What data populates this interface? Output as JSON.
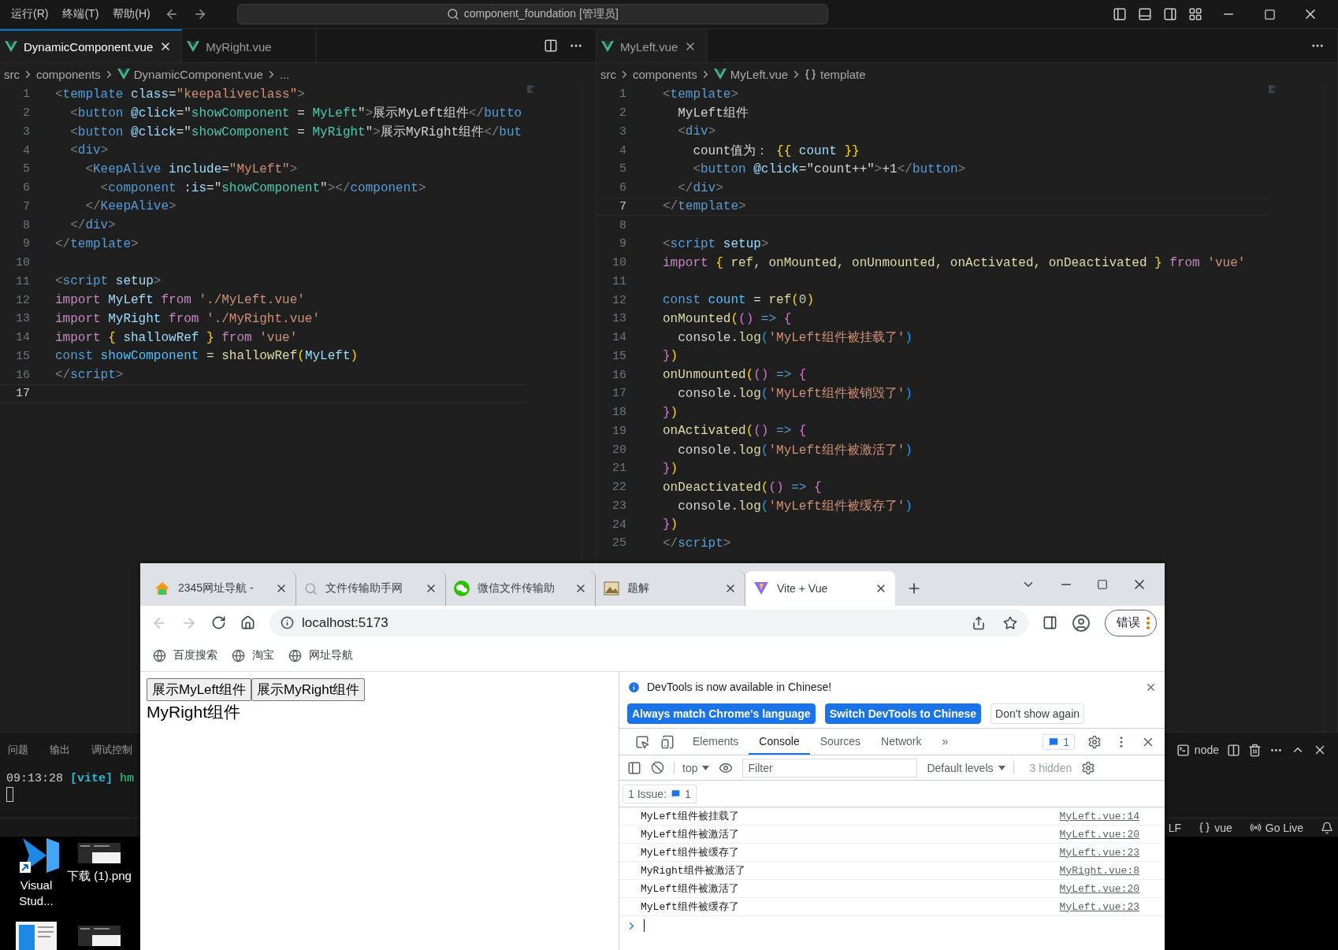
{
  "vscode": {
    "menu": [
      "运行(R)",
      "终端(T)",
      "帮助(H)"
    ],
    "command_center": "component_foundation [管理员]",
    "editors": [
      {
        "focused": true,
        "tabs": [
          {
            "label": "DynamicComponent.vue",
            "selected": true
          },
          {
            "label": "MyRight.vue",
            "selected": false
          }
        ],
        "breadcrumbs": [
          {
            "kind": "folder",
            "text": "src"
          },
          {
            "kind": "folder",
            "text": "components"
          },
          {
            "kind": "file",
            "text": "DynamicComponent.vue"
          },
          {
            "kind": "more",
            "text": "..."
          }
        ],
        "lines": [
          {
            "number": "1",
            "current": false,
            "tokens": [
              {
                "kind": "punctuation",
                "text": "<"
              },
              {
                "kind": "tag",
                "text": "template"
              },
              {
                "kind": "attribute",
                "text": " class"
              },
              {
                "kind": "text",
                "text": "="
              },
              {
                "kind": "string",
                "text": "\"keepaliveclass\""
              },
              {
                "kind": "punctuation",
                "text": ">"
              }
            ]
          },
          {
            "number": "2",
            "current": false,
            "tokens": [
              {
                "kind": "punctuation",
                "text": "  <"
              },
              {
                "kind": "tag",
                "text": "button"
              },
              {
                "kind": "attribute",
                "text": " @click"
              },
              {
                "kind": "text",
                "text": "=\""
              },
              {
                "kind": "expression",
                "text": "showComponent"
              },
              {
                "kind": "text",
                "text": " = "
              },
              {
                "kind": "expression",
                "text": "MyLeft"
              },
              {
                "kind": "text",
                "text": "\""
              },
              {
                "kind": "punctuation",
                "text": ">"
              },
              {
                "kind": "text",
                "text": "展示MyLeft组件"
              },
              {
                "kind": "punctuation",
                "text": "</"
              },
              {
                "kind": "tag",
                "text": "butto"
              }
            ]
          },
          {
            "number": "3",
            "current": false,
            "tokens": [
              {
                "kind": "punctuation",
                "text": "  <"
              },
              {
                "kind": "tag",
                "text": "button"
              },
              {
                "kind": "attribute",
                "text": " @click"
              },
              {
                "kind": "text",
                "text": "=\""
              },
              {
                "kind": "expression",
                "text": "showComponent"
              },
              {
                "kind": "text",
                "text": " = "
              },
              {
                "kind": "expression",
                "text": "MyRight"
              },
              {
                "kind": "text",
                "text": "\""
              },
              {
                "kind": "punctuation",
                "text": ">"
              },
              {
                "kind": "text",
                "text": "展示MyRight组件"
              },
              {
                "kind": "punctuation",
                "text": "</"
              },
              {
                "kind": "tag",
                "text": "but"
              }
            ]
          },
          {
            "number": "4",
            "current": false,
            "tokens": [
              {
                "kind": "punctuation",
                "text": "  <"
              },
              {
                "kind": "tag",
                "text": "div"
              },
              {
                "kind": "punctuation",
                "text": ">"
              }
            ]
          },
          {
            "number": "5",
            "current": false,
            "tokens": [
              {
                "kind": "punctuation",
                "text": "    <"
              },
              {
                "kind": "tag",
                "text": "KeepAlive"
              },
              {
                "kind": "attribute",
                "text": " include"
              },
              {
                "kind": "text",
                "text": "="
              },
              {
                "kind": "string",
                "text": "\"MyLeft\""
              },
              {
                "kind": "punctuation",
                "text": ">"
              }
            ]
          },
          {
            "number": "6",
            "current": false,
            "tokens": [
              {
                "kind": "punctuation",
                "text": "      <"
              },
              {
                "kind": "tag",
                "text": "component"
              },
              {
                "kind": "attribute",
                "text": " :is"
              },
              {
                "kind": "text",
                "text": "=\""
              },
              {
                "kind": "expression",
                "text": "showComponent"
              },
              {
                "kind": "text",
                "text": "\""
              },
              {
                "kind": "punctuation",
                "text": "></"
              },
              {
                "kind": "tag",
                "text": "component"
              },
              {
                "kind": "punctuation",
                "text": ">"
              }
            ]
          },
          {
            "number": "7",
            "current": false,
            "tokens": [
              {
                "kind": "punctuation",
                "text": "    </"
              },
              {
                "kind": "tag",
                "text": "KeepAlive"
              },
              {
                "kind": "punctuation",
                "text": ">"
              }
            ]
          },
          {
            "number": "8",
            "current": false,
            "tokens": [
              {
                "kind": "punctuation",
                "text": "  </"
              },
              {
                "kind": "tag",
                "text": "div"
              },
              {
                "kind": "punctuation",
                "text": ">"
              }
            ]
          },
          {
            "number": "9",
            "current": false,
            "tokens": [
              {
                "kind": "punctuation",
                "text": "</"
              },
              {
                "kind": "tag",
                "text": "template"
              },
              {
                "kind": "punctuation",
                "text": ">"
              }
            ]
          },
          {
            "number": "10",
            "current": false
          },
          {
            "number": "11",
            "current": false,
            "tokens": [
              {
                "kind": "punctuation",
                "text": "<"
              },
              {
                "kind": "tag",
                "text": "script"
              },
              {
                "kind": "attribute",
                "text": " setup"
              },
              {
                "kind": "punctuation",
                "text": ">"
              }
            ]
          },
          {
            "number": "12",
            "current": false,
            "tokens": [
              {
                "kind": "keyword",
                "text": "import"
              },
              {
                "kind": "attribute",
                "text": " MyLeft"
              },
              {
                "kind": "keyword",
                "text": " from"
              },
              {
                "kind": "string",
                "text": " './MyLeft.vue'"
              }
            ]
          },
          {
            "number": "13",
            "current": false,
            "tokens": [
              {
                "kind": "keyword",
                "text": "import"
              },
              {
                "kind": "attribute",
                "text": " MyRight"
              },
              {
                "kind": "keyword",
                "text": " from"
              },
              {
                "kind": "string",
                "text": " './MyRight.vue'"
              }
            ]
          },
          {
            "number": "14",
            "current": false,
            "tokens": [
              {
                "kind": "keyword",
                "text": "import"
              },
              {
                "kind": "bracket1",
                "text": " {"
              },
              {
                "kind": "attribute",
                "text": " shallowRef"
              },
              {
                "kind": "bracket1",
                "text": " }"
              },
              {
                "kind": "keyword",
                "text": " from"
              },
              {
                "kind": "string",
                "text": " 'vue'"
              }
            ]
          },
          {
            "number": "15",
            "current": false,
            "tokens": [
              {
                "kind": "declaration",
                "text": "const"
              },
              {
                "kind": "variable",
                "text": " showComponent"
              },
              {
                "kind": "text",
                "text": " = "
              },
              {
                "kind": "function",
                "text": "shallowRef"
              },
              {
                "kind": "bracket1",
                "text": "("
              },
              {
                "kind": "attribute",
                "text": "MyLeft"
              },
              {
                "kind": "bracket1",
                "text": ")"
              }
            ]
          },
          {
            "number": "16",
            "current": false,
            "tokens": [
              {
                "kind": "punctuation",
                "text": "</"
              },
              {
                "kind": "tag",
                "text": "script"
              },
              {
                "kind": "punctuation",
                "text": ">"
              }
            ]
          },
          {
            "number": "17",
            "current": true
          }
        ]
      },
      {
        "focused": false,
        "tabs": [
          {
            "label": "MyLeft.vue",
            "selected": true
          }
        ],
        "breadcrumbs": [
          {
            "kind": "folder",
            "text": "src"
          },
          {
            "kind": "folder",
            "text": "components"
          },
          {
            "kind": "file",
            "text": "MyLeft.vue"
          },
          {
            "kind": "symbol",
            "text": "template"
          }
        ],
        "lines": [
          {
            "number": "1",
            "current": false,
            "tokens": [
              {
                "kind": "punctuation",
                "text": "<"
              },
              {
                "kind": "tag",
                "text": "template"
              },
              {
                "kind": "punctuation",
                "text": ">"
              }
            ]
          },
          {
            "number": "2",
            "current": false,
            "tokens": [
              {
                "kind": "text",
                "text": "  MyLeft组件"
              }
            ]
          },
          {
            "number": "3",
            "current": false,
            "tokens": [
              {
                "kind": "punctuation",
                "text": "  <"
              },
              {
                "kind": "tag",
                "text": "div"
              },
              {
                "kind": "punctuation",
                "text": ">"
              }
            ]
          },
          {
            "number": "4",
            "current": false,
            "tokens": [
              {
                "kind": "text",
                "text": "    count值为："
              },
              {
                "kind": "bracket1",
                "text": " {{"
              },
              {
                "kind": "attribute",
                "text": " count"
              },
              {
                "kind": "bracket1",
                "text": " }}"
              }
            ]
          },
          {
            "number": "5",
            "current": false,
            "tokens": [
              {
                "kind": "punctuation",
                "text": "    <"
              },
              {
                "kind": "tag",
                "text": "button"
              },
              {
                "kind": "attribute",
                "text": " @click"
              },
              {
                "kind": "text",
                "text": "=\"count++\""
              },
              {
                "kind": "punctuation",
                "text": ">"
              },
              {
                "kind": "text",
                "text": "+1"
              },
              {
                "kind": "punctuation",
                "text": "</"
              },
              {
                "kind": "tag",
                "text": "button"
              },
              {
                "kind": "punctuation",
                "text": ">"
              }
            ]
          },
          {
            "number": "6",
            "current": false,
            "tokens": [
              {
                "kind": "punctuation",
                "text": "  </"
              },
              {
                "kind": "tag",
                "text": "div"
              },
              {
                "kind": "punctuation",
                "text": ">"
              }
            ]
          },
          {
            "number": "7",
            "current": true,
            "tokens": [
              {
                "kind": "punctuation",
                "text": "</"
              },
              {
                "kind": "tag",
                "text": "template"
              },
              {
                "kind": "punctuation",
                "text": ">"
              }
            ]
          },
          {
            "number": "8",
            "current": false
          },
          {
            "number": "9",
            "current": false,
            "tokens": [
              {
                "kind": "punctuation",
                "text": "<"
              },
              {
                "kind": "tag",
                "text": "script"
              },
              {
                "kind": "attribute",
                "text": " setup"
              },
              {
                "kind": "punctuation",
                "text": ">"
              }
            ]
          },
          {
            "number": "10",
            "current": false,
            "tokens": [
              {
                "kind": "keyword",
                "text": "import"
              },
              {
                "kind": "bracket1",
                "text": " {"
              },
              {
                "kind": "function",
                "text": " ref, onMounted, onUnmounted, onActivated, onDeactivated"
              },
              {
                "kind": "bracket1",
                "text": " }"
              },
              {
                "kind": "keyword",
                "text": " from"
              },
              {
                "kind": "string",
                "text": " 'vue'"
              }
            ]
          },
          {
            "number": "11",
            "current": false
          },
          {
            "number": "12",
            "current": false,
            "tokens": [
              {
                "kind": "declaration",
                "text": "const"
              },
              {
                "kind": "variable",
                "text": " count"
              },
              {
                "kind": "text",
                "text": " = "
              },
              {
                "kind": "function",
                "text": "ref"
              },
              {
                "kind": "bracket1",
                "text": "("
              },
              {
                "kind": "number",
                "text": "0"
              },
              {
                "kind": "bracket1",
                "text": ")"
              }
            ]
          },
          {
            "number": "13",
            "current": false,
            "tokens": [
              {
                "kind": "function",
                "text": "onMounted"
              },
              {
                "kind": "bracket1",
                "text": "("
              },
              {
                "kind": "bracket2",
                "text": "()"
              },
              {
                "kind": "declaration",
                "text": " =>"
              },
              {
                "kind": "bracket2",
                "text": " {"
              }
            ]
          },
          {
            "number": "14",
            "current": false,
            "tokens": [
              {
                "kind": "text",
                "text": "  console."
              },
              {
                "kind": "function",
                "text": "log"
              },
              {
                "kind": "bracket3",
                "text": "("
              },
              {
                "kind": "string",
                "text": "'MyLeft组件被挂载了'"
              },
              {
                "kind": "bracket3",
                "text": ")"
              }
            ]
          },
          {
            "number": "15",
            "current": false,
            "tokens": [
              {
                "kind": "bracket2",
                "text": "}"
              },
              {
                "kind": "bracket1",
                "text": ")"
              }
            ]
          },
          {
            "number": "16",
            "current": false,
            "tokens": [
              {
                "kind": "function",
                "text": "onUnmounted"
              },
              {
                "kind": "bracket1",
                "text": "("
              },
              {
                "kind": "bracket2",
                "text": "()"
              },
              {
                "kind": "declaration",
                "text": " =>"
              },
              {
                "kind": "bracket2",
                "text": " {"
              }
            ]
          },
          {
            "number": "17",
            "current": false,
            "tokens": [
              {
                "kind": "text",
                "text": "  console."
              },
              {
                "kind": "function",
                "text": "log"
              },
              {
                "kind": "bracket3",
                "text": "("
              },
              {
                "kind": "string",
                "text": "'MyLeft组件被销毁了'"
              },
              {
                "kind": "bracket3",
                "text": ")"
              }
            ]
          },
          {
            "number": "18",
            "current": false,
            "tokens": [
              {
                "kind": "bracket2",
                "text": "}"
              },
              {
                "kind": "bracket1",
                "text": ")"
              }
            ]
          },
          {
            "number": "19",
            "current": false,
            "tokens": [
              {
                "kind": "function",
                "text": "onActivated"
              },
              {
                "kind": "bracket1",
                "text": "("
              },
              {
                "kind": "bracket2",
                "text": "()"
              },
              {
                "kind": "declaration",
                "text": " =>"
              },
              {
                "kind": "bracket2",
                "text": " {"
              }
            ]
          },
          {
            "number": "20",
            "current": false,
            "tokens": [
              {
                "kind": "text",
                "text": "  console."
              },
              {
                "kind": "function",
                "text": "log"
              },
              {
                "kind": "bracket3",
                "text": "("
              },
              {
                "kind": "string",
                "text": "'MyLeft组件被激活了'"
              },
              {
                "kind": "bracket3",
                "text": ")"
              }
            ]
          },
          {
            "number": "21",
            "current": false,
            "tokens": [
              {
                "kind": "bracket2",
                "text": "}"
              },
              {
                "kind": "bracket1",
                "text": ")"
              }
            ]
          },
          {
            "number": "22",
            "current": false,
            "tokens": [
              {
                "kind": "function",
                "text": "onDeactivated"
              },
              {
                "kind": "bracket1",
                "text": "("
              },
              {
                "kind": "bracket2",
                "text": "()"
              },
              {
                "kind": "declaration",
                "text": " =>"
              },
              {
                "kind": "bracket2",
                "text": " {"
              }
            ]
          },
          {
            "number": "23",
            "current": false,
            "tokens": [
              {
                "kind": "text",
                "text": "  console."
              },
              {
                "kind": "function",
                "text": "log"
              },
              {
                "kind": "bracket3",
                "text": "("
              },
              {
                "kind": "string",
                "text": "'MyLeft组件被缓存了'"
              },
              {
                "kind": "bracket3",
                "text": ")"
              }
            ]
          },
          {
            "number": "24",
            "current": false,
            "tokens": [
              {
                "kind": "bracket2",
                "text": "}"
              },
              {
                "kind": "bracket1",
                "text": ")"
              }
            ]
          },
          {
            "number": "25",
            "current": false,
            "tokens": [
              {
                "kind": "punctuation",
                "text": "</"
              },
              {
                "kind": "tag",
                "text": "script"
              },
              {
                "kind": "punctuation",
                "text": ">"
              }
            ]
          }
        ]
      }
    ],
    "panel": {
      "tabs": [
        "问题",
        "输出",
        "调试控制"
      ],
      "terminal_name": "node",
      "terminal_lines": [
        {
          "time": "09:13:28",
          "source": "[vite]",
          "message": "hm"
        }
      ]
    },
    "status_bar": {
      "line_ending": "LF",
      "language": "vue",
      "live_server": "Go Live"
    }
  },
  "desktop_icons": [
    {
      "kind": "app",
      "label": "Visual Stud..."
    },
    {
      "kind": "image",
      "label": "下载 (1).png"
    },
    {
      "kind": "document"
    },
    {
      "kind": "image"
    }
  ],
  "browser": {
    "tabs": [
      {
        "kind": "house",
        "title": "2345网址导航 -",
        "selected": false
      },
      {
        "kind": "search",
        "title": "文件传输助手网",
        "selected": false
      },
      {
        "kind": "chat",
        "title": "微信文件传输助",
        "selected": false
      },
      {
        "kind": "image",
        "title": "题解",
        "selected": false
      },
      {
        "kind": "vite",
        "title": "Vite + Vue",
        "selected": true
      }
    ],
    "address": "localhost:5173",
    "profile_button": "错误",
    "bookmarks": [
      "百度搜索",
      "淘宝",
      "网址导航"
    ],
    "page": {
      "buttons": [
        "展示MyLeft组件",
        "展示MyRight组件"
      ],
      "text": "MyRight组件"
    },
    "devtools": {
      "notice": "DevTools is now available in Chinese!",
      "notice_buttons": [
        {
          "kind": "primary",
          "label": "Always match Chrome's language"
        },
        {
          "kind": "primary",
          "label": "Switch DevTools to Chinese"
        },
        {
          "kind": "secondary",
          "label": "Don't show again"
        }
      ],
      "tabs": [
        {
          "label": "Elements",
          "selected": false
        },
        {
          "label": "Console",
          "selected": true
        },
        {
          "label": "Sources",
          "selected": false
        },
        {
          "label": "Network",
          "selected": false
        }
      ],
      "more_tabs": "»",
      "issue_badge": "1",
      "context": "top",
      "filter_placeholder": "Filter",
      "levels": "Default levels",
      "hidden": "3 hidden",
      "issues_label": "1 Issue:",
      "issues_count": "1",
      "messages": [
        {
          "text": "MyLeft组件被挂载了",
          "source": "MyLeft.vue:14"
        },
        {
          "text": "MyLeft组件被激活了",
          "source": "MyLeft.vue:20"
        },
        {
          "text": "MyLeft组件被缓存了",
          "source": "MyLeft.vue:23"
        },
        {
          "text": "MyRight组件被激活了",
          "source": "MyRight.vue:8"
        },
        {
          "text": "MyLeft组件被激活了",
          "source": "MyLeft.vue:20"
        },
        {
          "text": "MyLeft组件被缓存了",
          "source": "MyLeft.vue:23"
        }
      ]
    }
  }
}
